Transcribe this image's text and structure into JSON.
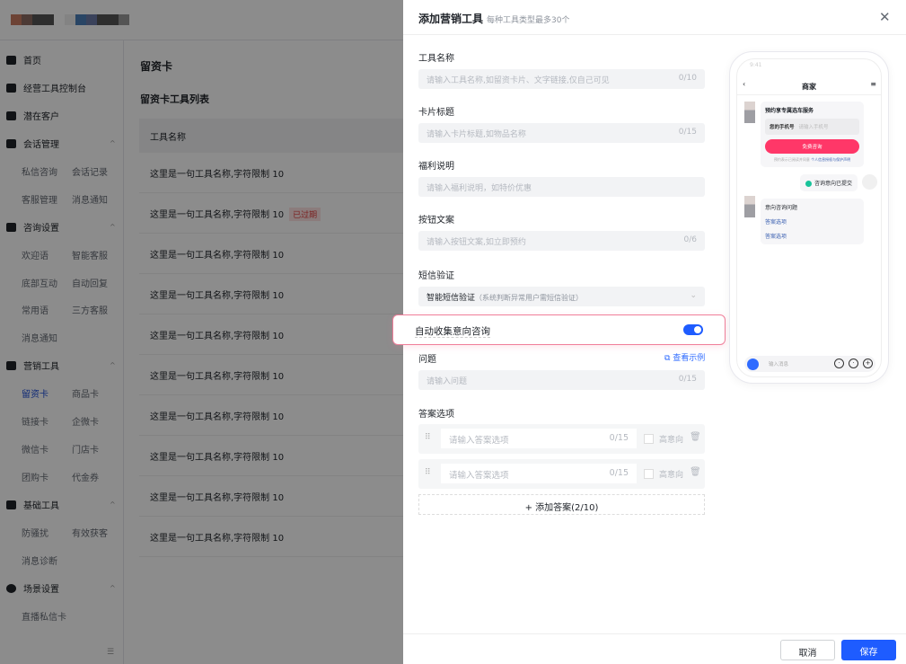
{
  "sidebar": {
    "home": "首页",
    "dashboard": "经营工具控制台",
    "leads": "潜在客户",
    "session": {
      "label": "会话管理",
      "items": [
        "私信咨询",
        "会话记录",
        "客服管理",
        "消息通知"
      ]
    },
    "consult": {
      "label": "咨询设置",
      "items": [
        "欢迎语",
        "智能客服",
        "底部互动",
        "自动回复",
        "常用语",
        "三方客服",
        "消息通知"
      ]
    },
    "marketing": {
      "label": "营销工具",
      "items": [
        "留资卡",
        "商品卡",
        "链接卡",
        "企微卡",
        "微信卡",
        "门店卡",
        "团购卡",
        "代金券"
      ]
    },
    "basic": {
      "label": "基础工具",
      "items": [
        "防骚扰",
        "有效获客",
        "消息诊断"
      ]
    },
    "scene": {
      "label": "场景设置",
      "items": [
        "直播私信卡"
      ]
    }
  },
  "main": {
    "title": "留资卡",
    "list_title": "留资卡工具列表",
    "column": "工具名称",
    "rows": [
      "这里是一句工具名称,字符限制 10",
      "这里是一句工具名称,字符限制 10",
      "这里是一句工具名称,字符限制 10",
      "这里是一句工具名称,字符限制 10",
      "这里是一句工具名称,字符限制 10",
      "这里是一句工具名称,字符限制 10",
      "这里是一句工具名称,字符限制 10",
      "这里是一句工具名称,字符限制 10",
      "这里是一句工具名称,字符限制 10",
      "这里是一句工具名称,字符限制 10"
    ],
    "expired_tag": "已过期"
  },
  "drawer": {
    "title": "添加营销工具",
    "subtitle": "每种工具类型最多30个",
    "close": "✕",
    "fields": [
      {
        "label": "工具名称",
        "placeholder": "请输入工具名称,如留资卡片、文字链接,仅自己可见",
        "count": "0/10"
      },
      {
        "label": "卡片标题",
        "placeholder": "请输入卡片标题,如物品名称",
        "count": "0/15"
      },
      {
        "label": "福利说明",
        "placeholder": "请输入福利说明，如特价优惠",
        "count": ""
      },
      {
        "label": "按钮文案",
        "placeholder": "请输入按钮文案,如立即预约",
        "count": "0/6"
      }
    ],
    "sms": {
      "label": "短信验证",
      "value": "智能短信验证",
      "hint": "（系统判断异常用户需短信验证）"
    },
    "auto_collect": {
      "label": "自动收集意向咨询",
      "enabled": true
    },
    "question": {
      "label": "问题",
      "example": "查看示例",
      "placeholder": "请输入问题",
      "count": "0/15"
    },
    "answers": {
      "label": "答案选项",
      "items": [
        {
          "placeholder": "请输入答案选项",
          "count": "0/15",
          "high": "高意向"
        },
        {
          "placeholder": "请输入答案选项",
          "count": "0/15",
          "high": "高意向"
        }
      ],
      "add": "+ 添加答案(2/10)"
    },
    "cancel": "取消",
    "save": "保存"
  },
  "preview": {
    "time": "9:41",
    "merchant": "商家",
    "card_title": "预约享专属选车服务",
    "phone_label": "您的手机号",
    "phone_placeholder": "请输入手机号",
    "button": "免费咨询",
    "note": "预约表示已阅读并同意",
    "note_link": "个人信息授权与保护声明",
    "submitted": "咨询意向已提交",
    "question_title": "意向咨询问题",
    "options": [
      "答案选项",
      "答案选项"
    ],
    "input_placeholder": "输入消息"
  },
  "colors": {
    "accent": "#1e5cff",
    "brand": "#ff3768",
    "danger": "#e03b3b"
  }
}
